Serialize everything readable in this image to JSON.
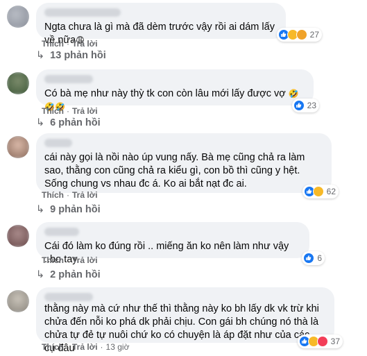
{
  "labels": {
    "like": "Thích",
    "reply": "Trả lời",
    "dot": "·"
  },
  "comments": [
    {
      "text": "Ngta chưa là gì mà đã dèm trước vậy rồi ai dám lấy về nữa",
      "emoji": "😩",
      "reactions": [
        "like",
        "haha",
        "wow"
      ],
      "reaction_count": "27",
      "replies": "13 phản hồi"
    },
    {
      "text": "Có bà mẹ như này thỳ tk con còn lâu mới lấy được vợ",
      "emoji": "🤣🤣🤣",
      "reactions": [
        "like"
      ],
      "reaction_count": "23",
      "replies": "6 phản hồi"
    },
    {
      "text": "cái này gọi là nồi nào úp vung nấy. Bà mẹ cũng chả ra làm sao, thằng con cũng chả ra kiểu gì, con bồ thì cũng y hệt. Sống chung vs nhau đc á. Ko ai bắt nạt đc ai.",
      "emoji": "",
      "reactions": [
        "like",
        "haha"
      ],
      "reaction_count": "62",
      "replies": "9 phản hồi"
    },
    {
      "text": "Cái đó làm ko đúng rồi .. miếng ăn ko nên làm như vậy ..bo tay..",
      "emoji": "",
      "reactions": [
        "like"
      ],
      "reaction_count": "6",
      "replies": "2 phản hồi"
    },
    {
      "text": "thằng này mà cứ như thế thì thằng này ko bh lấy dk vk trừ khi chửa đến nỗi ko phá dk phải chịu. Con gái bh chúng nó thà là chửa tự đẻ tự nuôi chứ ko có chuyện là áp đặt như của các cụ đâu",
      "emoji": "",
      "reactions": [
        "like",
        "haha",
        "love"
      ],
      "reaction_count": "37",
      "time": "13 giờ"
    }
  ],
  "colors": {
    "like": "#1877f2",
    "haha": "#f7b928",
    "love": "#f33e58",
    "secondary_text": "#65676b",
    "bubble": "#f0f2f5"
  }
}
